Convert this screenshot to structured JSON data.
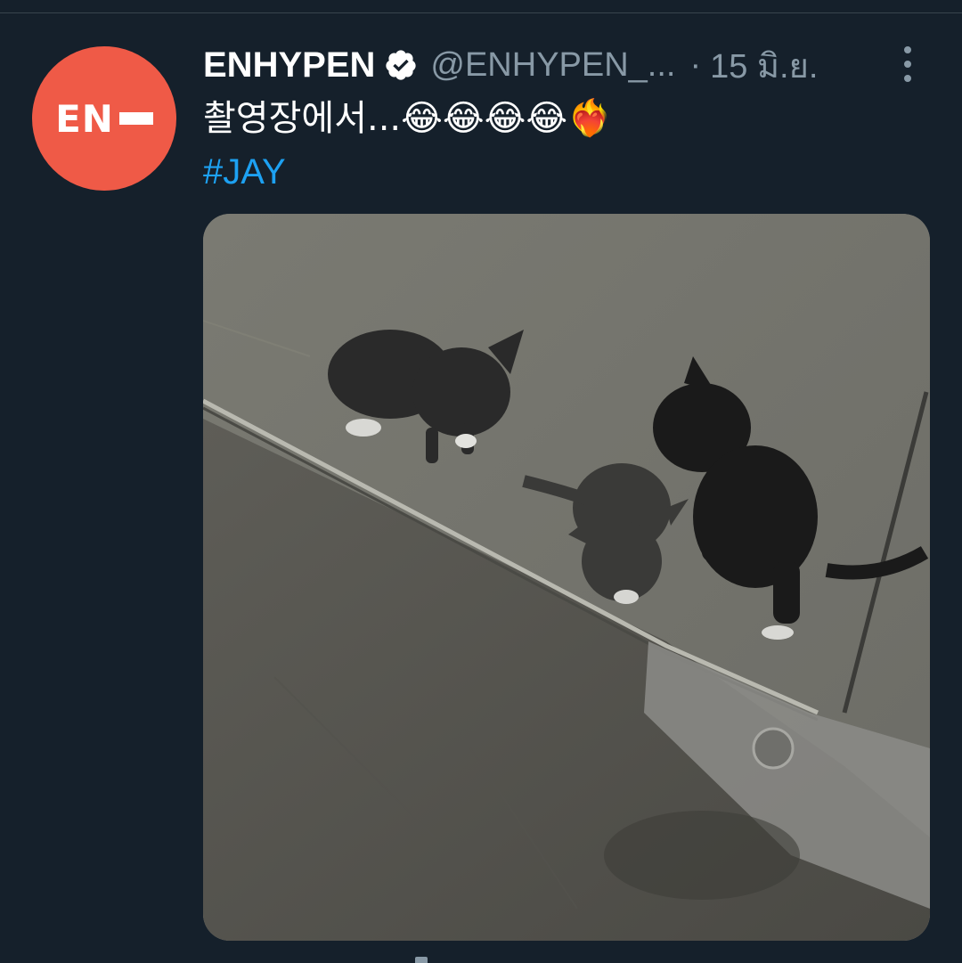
{
  "tweet": {
    "author": {
      "display_name": "ENHYPEN",
      "handle": "@ENHYPEN_...",
      "avatar_text": "EN",
      "verified": true
    },
    "separator": "·",
    "date": "15 มิ.ย.",
    "text": "촬영장에서...😂😂😂😂❤️‍🔥",
    "hashtag": "#JAY",
    "media": {
      "type": "video-thumbnail"
    }
  },
  "colors": {
    "background": "#15202b",
    "avatar_bg": "#ef5a47",
    "link": "#1da1f2",
    "muted_text": "#8899a6"
  },
  "icons": {
    "verified": "verified-badge-icon",
    "more": "more-vertical-icon"
  }
}
